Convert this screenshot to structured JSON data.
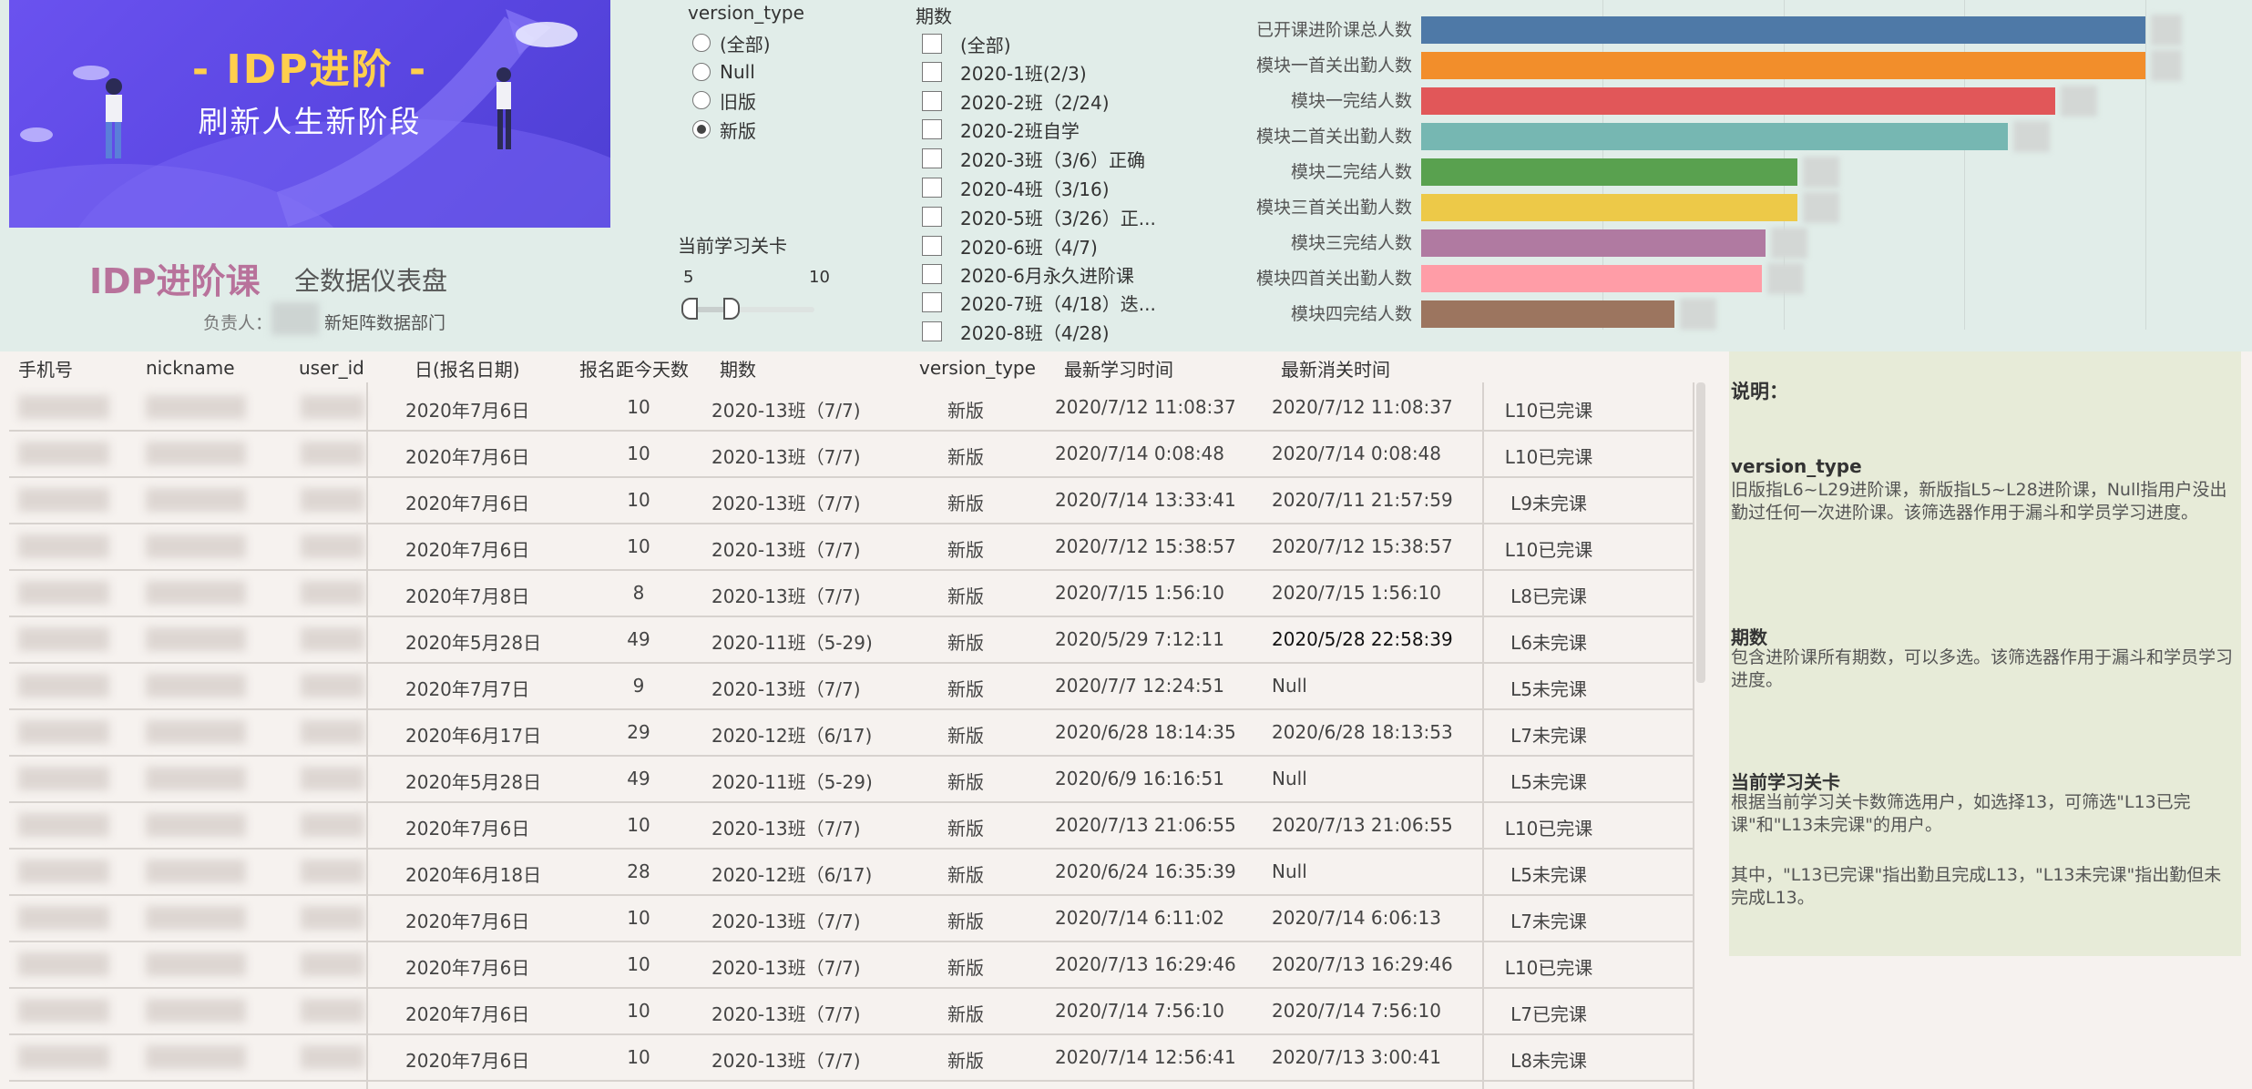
{
  "banner": {
    "title": "- IDP进阶 -",
    "subtitle": "刷新人生新阶段"
  },
  "header": {
    "title": "IDP进阶课",
    "subtitle": "全数据仪表盘",
    "owner_label": "负责人：",
    "owner_dept": "新矩阵数据部门"
  },
  "version_slicer": {
    "title": "version_type",
    "options": [
      "(全部)",
      "Null",
      "旧版",
      "新版"
    ],
    "selected": "新版"
  },
  "level_slicer": {
    "title": "当前学习关卡",
    "min": "5",
    "max": "10"
  },
  "period_slicer": {
    "title": "期数",
    "options": [
      "(全部)",
      "2020-1班(2/3)",
      "2020-2班（2/24)",
      "2020-2班自学",
      "2020-3班（3/6）正确",
      "2020-4班（3/16)",
      "2020-5班（3/26）正...",
      "2020-6班（4/7)",
      "2020-6月永久进阶课",
      "2020-7班（4/18）迭...",
      "2020-8班（4/28)"
    ]
  },
  "colors": {
    "accent_title": "#b8729b",
    "banner": "#5a46e2",
    "banner_title": "#ffcf4d"
  },
  "chart_data": {
    "type": "bar",
    "orientation": "horizontal",
    "categories": [
      "已开课进阶课总人数",
      "模块一首关出勤人数",
      "模块一完结人数",
      "模块二首关出勤人数",
      "模块二完结人数",
      "模块三首关出勤人数",
      "模块三完结人数",
      "模块四首关出勤人数",
      "模块四完结人数"
    ],
    "values": [
      100,
      100,
      87.5,
      81,
      52,
      52,
      47.5,
      47,
      35
    ],
    "value_labels_visible": false,
    "colors": [
      "#4e79a7",
      "#f28e2b",
      "#e15759",
      "#76b7b2",
      "#59a14f",
      "#edc948",
      "#b07aa1",
      "#ff9da7",
      "#9c755f"
    ],
    "grid": true
  },
  "table": {
    "columns": [
      "手机号",
      "nickname",
      "user_id",
      "日(报名日期)",
      "报名距今天数",
      "期数",
      "version_type",
      "最新学习时间",
      "最新消关时间"
    ],
    "rows": [
      [
        "2020年7月6日",
        "10",
        "2020-13班（7/7)",
        "新版",
        "2020/7/12 11:08:37",
        "2020/7/12 11:08:37",
        "L10已完课"
      ],
      [
        "2020年7月6日",
        "10",
        "2020-13班（7/7)",
        "新版",
        "2020/7/14 0:08:48",
        "2020/7/14 0:08:48",
        "L10已完课"
      ],
      [
        "2020年7月6日",
        "10",
        "2020-13班（7/7)",
        "新版",
        "2020/7/14 13:33:41",
        "2020/7/11 21:57:59",
        "L9未完课"
      ],
      [
        "2020年7月6日",
        "10",
        "2020-13班（7/7)",
        "新版",
        "2020/7/12 15:38:57",
        "2020/7/12 15:38:57",
        "L10已完课"
      ],
      [
        "2020年7月8日",
        "8",
        "2020-13班（7/7)",
        "新版",
        "2020/7/15 1:56:10",
        "2020/7/15 1:56:10",
        "L8已完课"
      ],
      [
        "2020年5月28日",
        "49",
        "2020-11班（5-29)",
        "新版",
        "2020/5/29 7:12:11",
        "2020/5/28 22:58:39",
        "L6未完课"
      ],
      [
        "2020年7月7日",
        "9",
        "2020-13班（7/7)",
        "新版",
        "2020/7/7 12:24:51",
        "Null",
        "L5未完课"
      ],
      [
        "2020年6月17日",
        "29",
        "2020-12班（6/17)",
        "新版",
        "2020/6/28 18:14:35",
        "2020/6/28 18:13:53",
        "L7未完课"
      ],
      [
        "2020年5月28日",
        "49",
        "2020-11班（5-29)",
        "新版",
        "2020/6/9 16:16:51",
        "Null",
        "L5未完课"
      ],
      [
        "2020年7月6日",
        "10",
        "2020-13班（7/7)",
        "新版",
        "2020/7/13 21:06:55",
        "2020/7/13 21:06:55",
        "L10已完课"
      ],
      [
        "2020年6月18日",
        "28",
        "2020-12班（6/17)",
        "新版",
        "2020/6/24 16:35:39",
        "Null",
        "L5未完课"
      ],
      [
        "2020年7月6日",
        "10",
        "2020-13班（7/7)",
        "新版",
        "2020/7/14 6:11:02",
        "2020/7/14 6:06:13",
        "L7未完课"
      ],
      [
        "2020年7月6日",
        "10",
        "2020-13班（7/7)",
        "新版",
        "2020/7/13 16:29:46",
        "2020/7/13 16:29:46",
        "L10已完课"
      ],
      [
        "2020年7月6日",
        "10",
        "2020-13班（7/7)",
        "新版",
        "2020/7/14 7:56:10",
        "2020/7/14 7:56:10",
        "L7已完课"
      ],
      [
        "2020年7月6日",
        "10",
        "2020-13班（7/7)",
        "新版",
        "2020/7/14 12:56:41",
        "2020/7/13 3:00:41",
        "L8未完课"
      ]
    ]
  },
  "notes": {
    "title": "说明：",
    "version_title": "version_type",
    "version_text": "旧版指L6~L29进阶课，新版指L5~L28进阶课，Null指用户没出勤过任何一次进阶课。该筛选器作用于漏斗和学员学习进度。",
    "period_title": "期数",
    "period_text": "包含进阶课所有期数，可以多选。该筛选器作用于漏斗和学员学习进度。",
    "level_title": "当前学习关卡",
    "level_text": "根据当前学习关卡数筛选用户，如选择13，可筛选\"L13已完课\"和\"L13未完课\"的用户。",
    "level_text2": "其中，\"L13已完课\"指出勤且完成L13，\"L13未完课\"指出勤但未完成L13。"
  }
}
